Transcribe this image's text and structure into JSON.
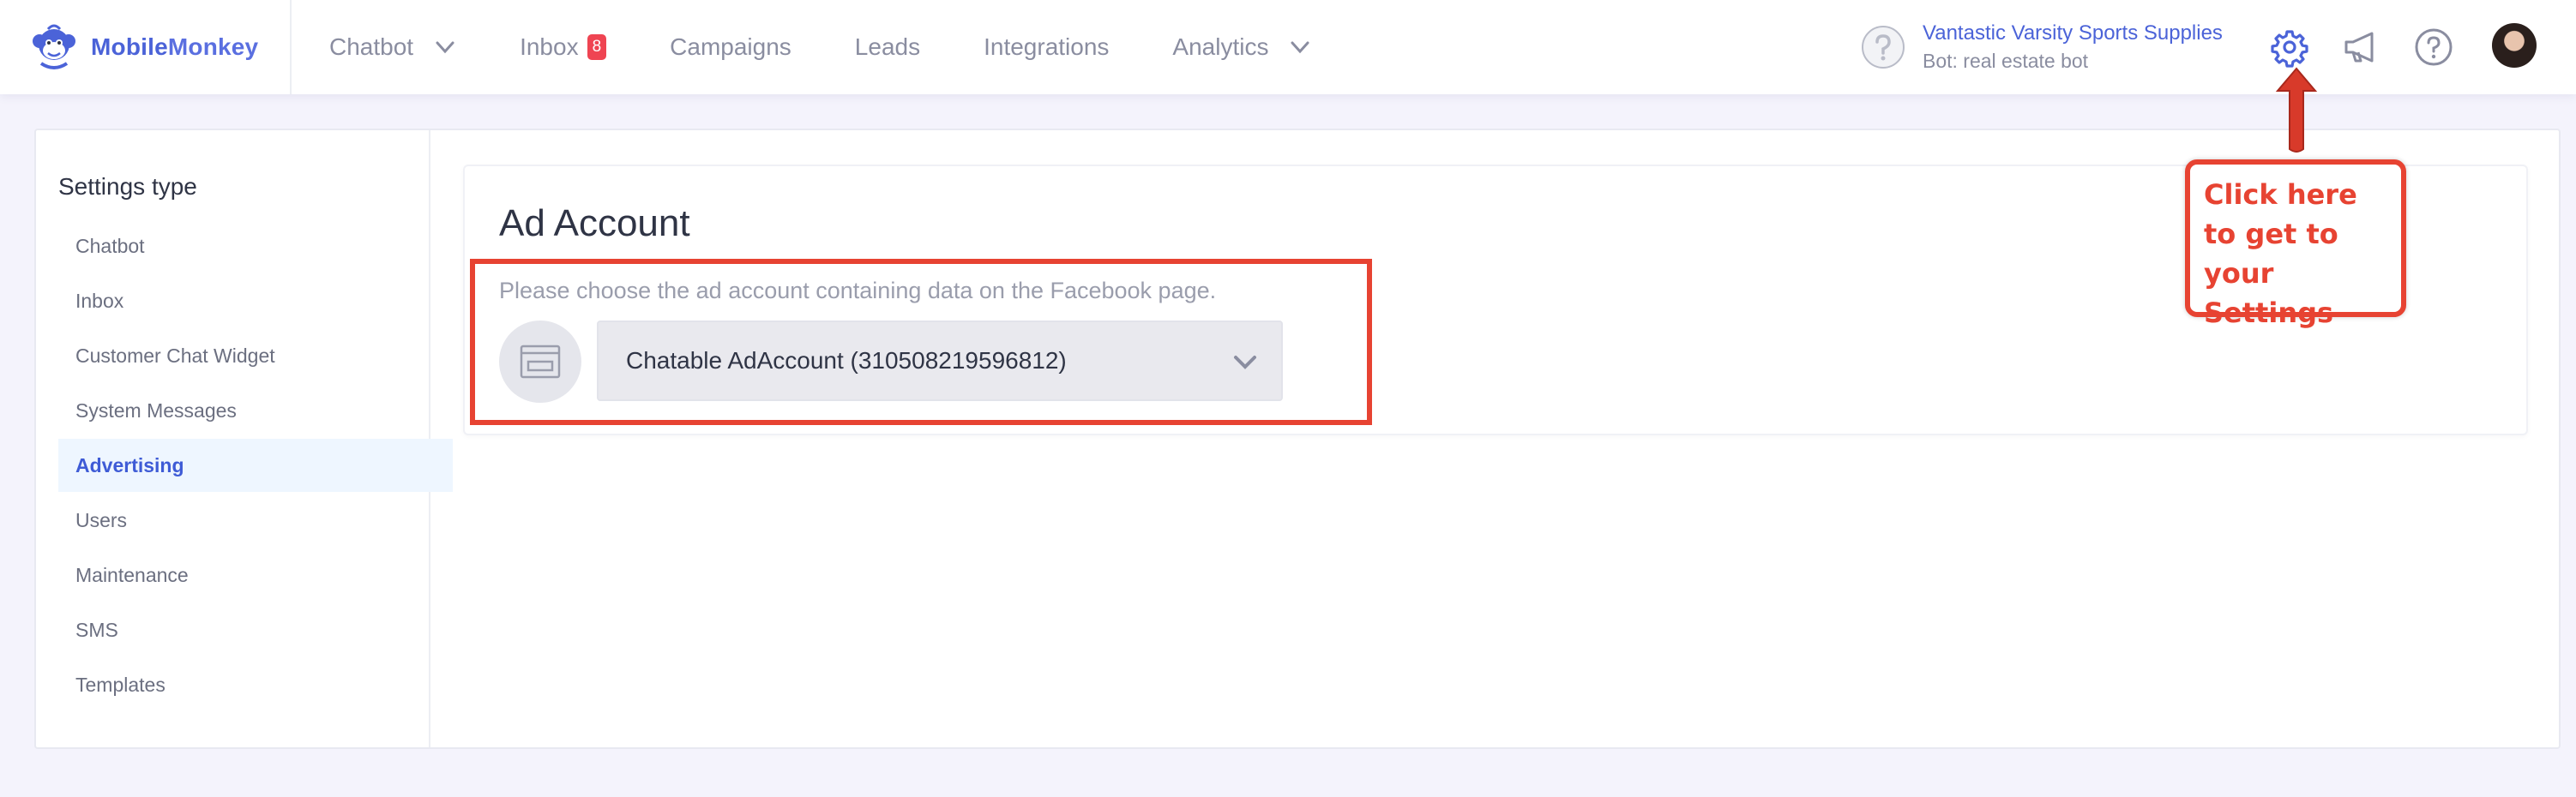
{
  "brand": {
    "name_dark": "Mobile",
    "name_light": "Monkey"
  },
  "nav": {
    "items": [
      {
        "label": "Chatbot",
        "dropdown": true
      },
      {
        "label": "Inbox",
        "badge": "8"
      },
      {
        "label": "Campaigns"
      },
      {
        "label": "Leads"
      },
      {
        "label": "Integrations"
      },
      {
        "label": "Analytics",
        "dropdown": true
      }
    ]
  },
  "account": {
    "name": "Vantastic Varsity Sports Supplies",
    "bot": "Bot: real estate bot"
  },
  "topIcons": [
    "gear-icon",
    "megaphone-icon",
    "help-icon"
  ],
  "sidebar": {
    "title": "Settings type",
    "items": [
      {
        "label": "Chatbot"
      },
      {
        "label": "Inbox"
      },
      {
        "label": "Customer Chat Widget"
      },
      {
        "label": "System Messages"
      },
      {
        "label": "Advertising",
        "active": true
      },
      {
        "label": "Users"
      },
      {
        "label": "Maintenance"
      },
      {
        "label": "SMS"
      },
      {
        "label": "Templates"
      }
    ]
  },
  "adAccount": {
    "title": "Ad Account",
    "description": "Please choose the ad account containing data on the Facebook page.",
    "selected": "Chatable AdAccount (310508219596812)"
  },
  "annotation": {
    "text": "Click here to get to your Settings"
  },
  "colors": {
    "accent": "#4b63d8",
    "annotation": "#e74332",
    "badge": "#ef4452",
    "active_bg": "#eef6ff"
  }
}
